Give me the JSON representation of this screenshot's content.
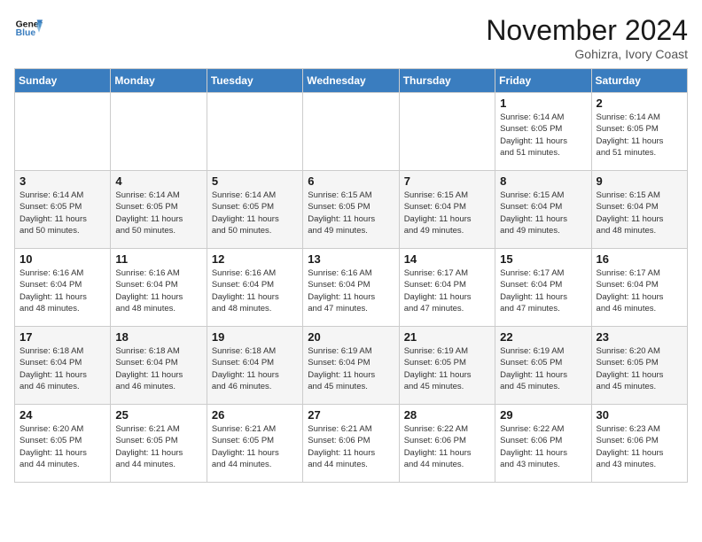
{
  "header": {
    "logo_line1": "General",
    "logo_line2": "Blue",
    "month_title": "November 2024",
    "location": "Gohizra, Ivory Coast"
  },
  "weekdays": [
    "Sunday",
    "Monday",
    "Tuesday",
    "Wednesday",
    "Thursday",
    "Friday",
    "Saturday"
  ],
  "weeks": [
    [
      {
        "day": "",
        "info": ""
      },
      {
        "day": "",
        "info": ""
      },
      {
        "day": "",
        "info": ""
      },
      {
        "day": "",
        "info": ""
      },
      {
        "day": "",
        "info": ""
      },
      {
        "day": "1",
        "info": "Sunrise: 6:14 AM\nSunset: 6:05 PM\nDaylight: 11 hours\nand 51 minutes."
      },
      {
        "day": "2",
        "info": "Sunrise: 6:14 AM\nSunset: 6:05 PM\nDaylight: 11 hours\nand 51 minutes."
      }
    ],
    [
      {
        "day": "3",
        "info": "Sunrise: 6:14 AM\nSunset: 6:05 PM\nDaylight: 11 hours\nand 50 minutes."
      },
      {
        "day": "4",
        "info": "Sunrise: 6:14 AM\nSunset: 6:05 PM\nDaylight: 11 hours\nand 50 minutes."
      },
      {
        "day": "5",
        "info": "Sunrise: 6:14 AM\nSunset: 6:05 PM\nDaylight: 11 hours\nand 50 minutes."
      },
      {
        "day": "6",
        "info": "Sunrise: 6:15 AM\nSunset: 6:05 PM\nDaylight: 11 hours\nand 49 minutes."
      },
      {
        "day": "7",
        "info": "Sunrise: 6:15 AM\nSunset: 6:04 PM\nDaylight: 11 hours\nand 49 minutes."
      },
      {
        "day": "8",
        "info": "Sunrise: 6:15 AM\nSunset: 6:04 PM\nDaylight: 11 hours\nand 49 minutes."
      },
      {
        "day": "9",
        "info": "Sunrise: 6:15 AM\nSunset: 6:04 PM\nDaylight: 11 hours\nand 48 minutes."
      }
    ],
    [
      {
        "day": "10",
        "info": "Sunrise: 6:16 AM\nSunset: 6:04 PM\nDaylight: 11 hours\nand 48 minutes."
      },
      {
        "day": "11",
        "info": "Sunrise: 6:16 AM\nSunset: 6:04 PM\nDaylight: 11 hours\nand 48 minutes."
      },
      {
        "day": "12",
        "info": "Sunrise: 6:16 AM\nSunset: 6:04 PM\nDaylight: 11 hours\nand 48 minutes."
      },
      {
        "day": "13",
        "info": "Sunrise: 6:16 AM\nSunset: 6:04 PM\nDaylight: 11 hours\nand 47 minutes."
      },
      {
        "day": "14",
        "info": "Sunrise: 6:17 AM\nSunset: 6:04 PM\nDaylight: 11 hours\nand 47 minutes."
      },
      {
        "day": "15",
        "info": "Sunrise: 6:17 AM\nSunset: 6:04 PM\nDaylight: 11 hours\nand 47 minutes."
      },
      {
        "day": "16",
        "info": "Sunrise: 6:17 AM\nSunset: 6:04 PM\nDaylight: 11 hours\nand 46 minutes."
      }
    ],
    [
      {
        "day": "17",
        "info": "Sunrise: 6:18 AM\nSunset: 6:04 PM\nDaylight: 11 hours\nand 46 minutes."
      },
      {
        "day": "18",
        "info": "Sunrise: 6:18 AM\nSunset: 6:04 PM\nDaylight: 11 hours\nand 46 minutes."
      },
      {
        "day": "19",
        "info": "Sunrise: 6:18 AM\nSunset: 6:04 PM\nDaylight: 11 hours\nand 46 minutes."
      },
      {
        "day": "20",
        "info": "Sunrise: 6:19 AM\nSunset: 6:04 PM\nDaylight: 11 hours\nand 45 minutes."
      },
      {
        "day": "21",
        "info": "Sunrise: 6:19 AM\nSunset: 6:05 PM\nDaylight: 11 hours\nand 45 minutes."
      },
      {
        "day": "22",
        "info": "Sunrise: 6:19 AM\nSunset: 6:05 PM\nDaylight: 11 hours\nand 45 minutes."
      },
      {
        "day": "23",
        "info": "Sunrise: 6:20 AM\nSunset: 6:05 PM\nDaylight: 11 hours\nand 45 minutes."
      }
    ],
    [
      {
        "day": "24",
        "info": "Sunrise: 6:20 AM\nSunset: 6:05 PM\nDaylight: 11 hours\nand 44 minutes."
      },
      {
        "day": "25",
        "info": "Sunrise: 6:21 AM\nSunset: 6:05 PM\nDaylight: 11 hours\nand 44 minutes."
      },
      {
        "day": "26",
        "info": "Sunrise: 6:21 AM\nSunset: 6:05 PM\nDaylight: 11 hours\nand 44 minutes."
      },
      {
        "day": "27",
        "info": "Sunrise: 6:21 AM\nSunset: 6:06 PM\nDaylight: 11 hours\nand 44 minutes."
      },
      {
        "day": "28",
        "info": "Sunrise: 6:22 AM\nSunset: 6:06 PM\nDaylight: 11 hours\nand 44 minutes."
      },
      {
        "day": "29",
        "info": "Sunrise: 6:22 AM\nSunset: 6:06 PM\nDaylight: 11 hours\nand 43 minutes."
      },
      {
        "day": "30",
        "info": "Sunrise: 6:23 AM\nSunset: 6:06 PM\nDaylight: 11 hours\nand 43 minutes."
      }
    ]
  ]
}
